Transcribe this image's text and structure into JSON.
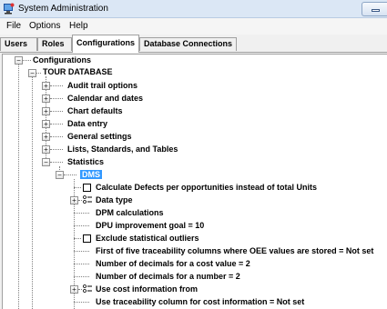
{
  "window": {
    "title": "System Administration"
  },
  "menu": [
    "File",
    "Options",
    "Help"
  ],
  "tabs": [
    "Users",
    "Roles",
    "Configurations",
    "Database Connections"
  ],
  "tree": {
    "root": "Configurations",
    "database": "TOUR DATABASE",
    "groups": [
      "Audit trail options",
      "Calendar and dates",
      "Chart defaults",
      "Data entry",
      "General settings",
      "Lists, Standards, and Tables",
      "Statistics"
    ],
    "selected": "DMS",
    "items": [
      "Calculate Defects per opportunities instead of total Units",
      "Data type",
      "DPM calculations",
      "DPU improvement goal = 10",
      "Exclude statistical outliers",
      "First of five traceability columns where OEE values are stored = Not set",
      "Number of decimals for a cost value = 2",
      "Number of decimals for a number = 2",
      "Use cost information from",
      "Use traceability column for cost information = Not set"
    ]
  }
}
